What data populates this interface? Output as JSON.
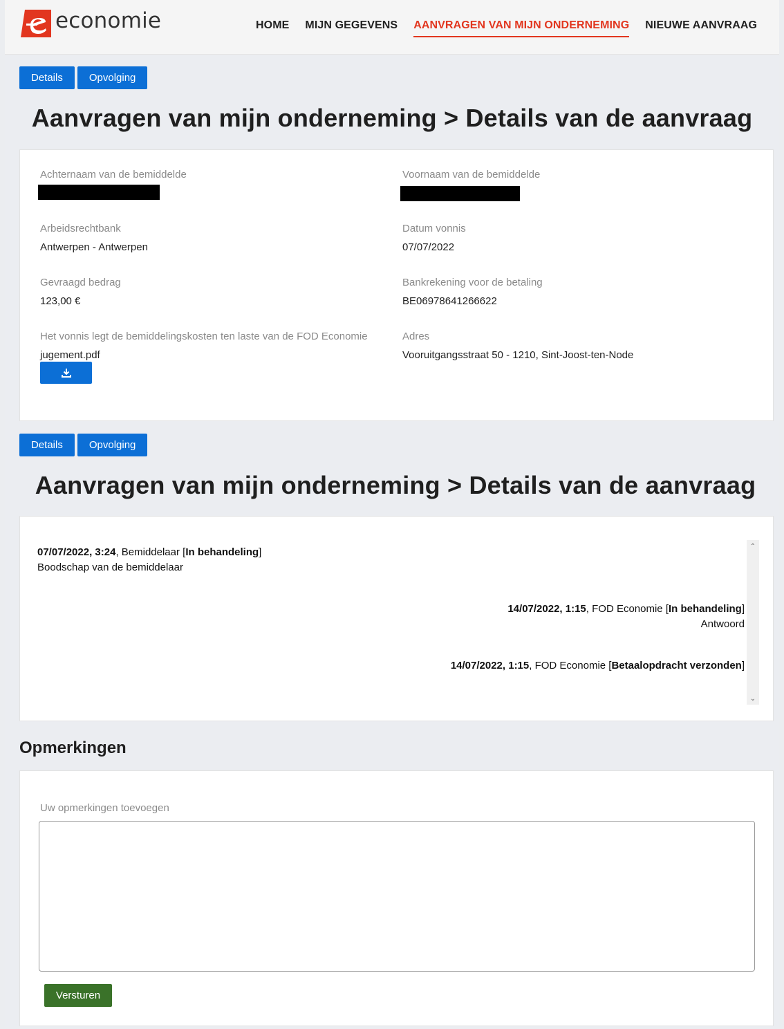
{
  "header": {
    "logo_text": "economie",
    "brand_color": "#e2361f",
    "nav": [
      {
        "label": "HOME",
        "active": false
      },
      {
        "label": "MIJN GEGEVENS",
        "active": false
      },
      {
        "label": "AANVRAGEN VAN MIJN ONDERNEMING",
        "active": true
      },
      {
        "label": "NIEUWE AANVRAAG",
        "active": false
      }
    ]
  },
  "tabs": {
    "details_label": "Details",
    "opvolging_label": "Opvolging"
  },
  "page_title": "Aanvragen van mijn onderneming > Details van de aanvraag",
  "details": {
    "achternaam_label": "Achternaam van de bemiddelde",
    "voornaam_label": "Voornaam van de bemiddelde",
    "arbeidsrechtbank_label": "Arbeidsrechtbank",
    "arbeidsrechtbank_value": "Antwerpen - Antwerpen",
    "datum_vonnis_label": "Datum vonnis",
    "datum_vonnis_value": "07/07/2022",
    "gevraagd_bedrag_label": "Gevraagd bedrag",
    "gevraagd_bedrag_value": "123,00 €",
    "bankrekening_label": "Bankrekening voor de betaling",
    "bankrekening_value": "BE06978641266622",
    "vonnis_label": "Het vonnis legt de bemiddelingskosten ten laste van de FOD Economie",
    "vonnis_file": "jugement.pdf",
    "adres_label": "Adres",
    "adres_value": "Vooruitgangsstraat 50 - 1210, Sint-Joost-ten-Node"
  },
  "messages": [
    {
      "timestamp": "07/07/2022, 3:24",
      "sender": ", Bemiddelaar [",
      "status": "In behandeling",
      "close": "]",
      "body": "Boodschap van de bemiddelaar",
      "align": "left"
    },
    {
      "timestamp": "14/07/2022, 1:15",
      "sender": ", FOD Economie [",
      "status": "In behandeling",
      "close": "]",
      "body": "Antwoord",
      "align": "right"
    },
    {
      "timestamp": "14/07/2022, 1:15",
      "sender": ", FOD Economie [",
      "status": "Betaalopdracht verzonden",
      "close": "]",
      "body": "",
      "align": "right"
    }
  ],
  "remarks": {
    "title": "Opmerkingen",
    "field_label": "Uw opmerkingen toevoegen",
    "textarea_value": "",
    "send_label": "Versturen"
  },
  "colors": {
    "primary_button": "#0c6fd6",
    "send_button": "#3a7229",
    "active_nav": "#e2361f"
  }
}
